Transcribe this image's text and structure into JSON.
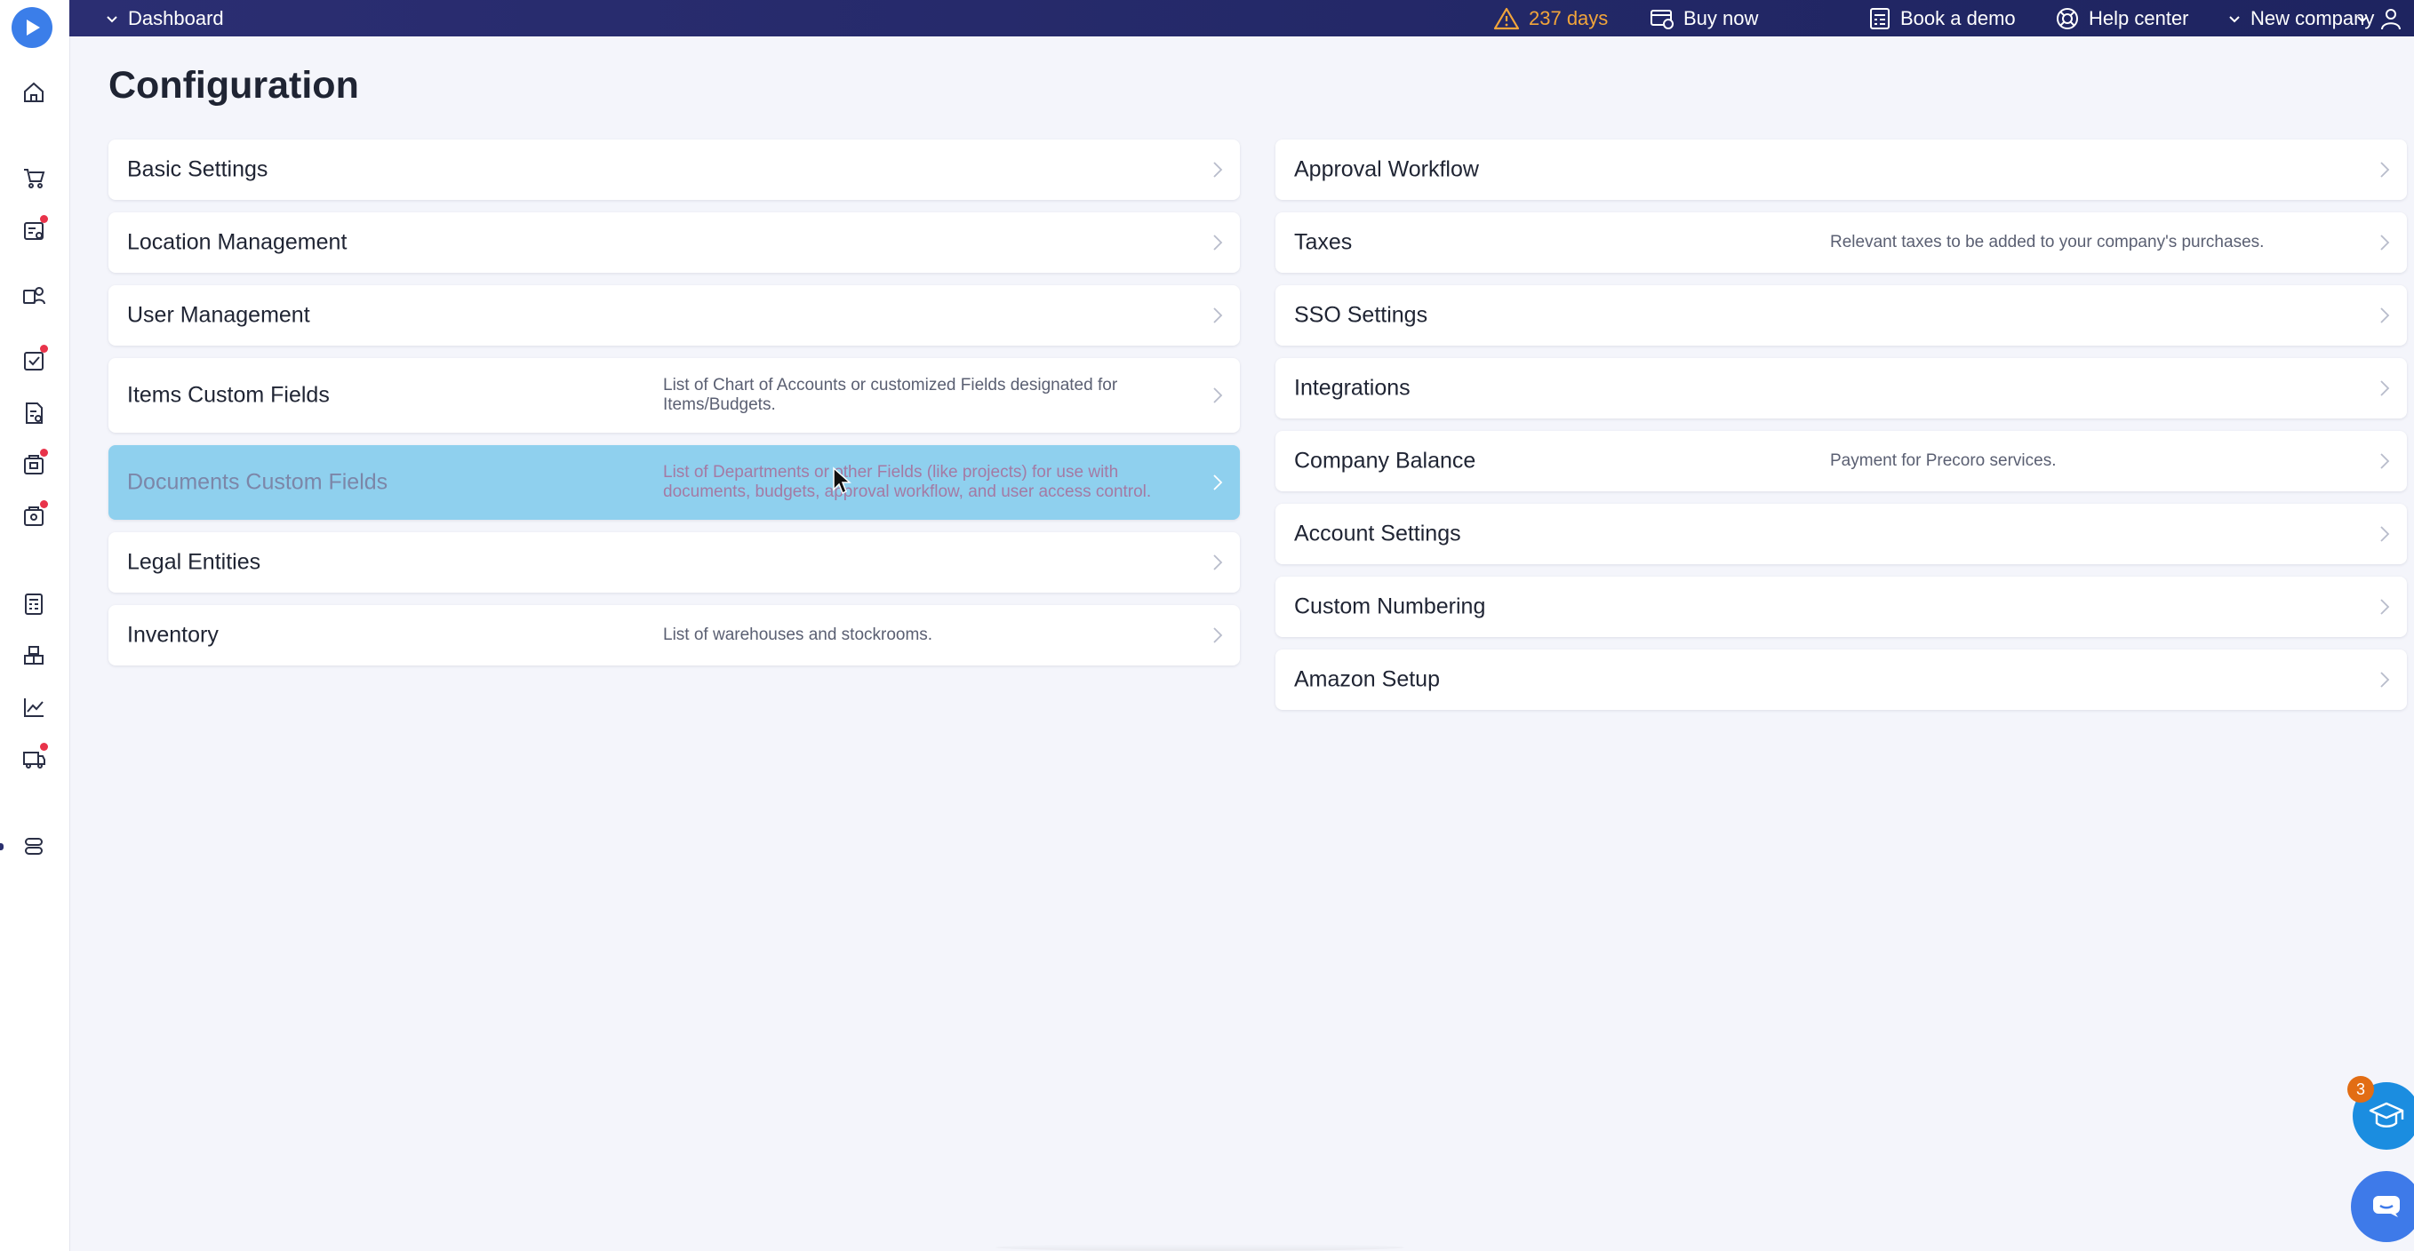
{
  "topbar": {
    "dashboard_label": "Dashboard",
    "trial_label": "237 days",
    "buy_now": "Buy now",
    "book_demo": "Book a demo",
    "help_center": "Help center",
    "company": "New company"
  },
  "page": {
    "title": "Configuration"
  },
  "left_cards": [
    {
      "title": "Basic Settings",
      "desc": ""
    },
    {
      "title": "Location Management",
      "desc": ""
    },
    {
      "title": "User Management",
      "desc": ""
    },
    {
      "title": "Items Custom Fields",
      "desc": "List of Chart of Accounts or customized Fields designated for Items/Budgets."
    },
    {
      "title": "Documents Custom Fields",
      "desc": "List of Departments or other Fields (like projects) for use with documents, budgets, approval workflow, and user access control."
    },
    {
      "title": "Legal Entities",
      "desc": ""
    },
    {
      "title": "Inventory",
      "desc": "List of warehouses and stockrooms."
    }
  ],
  "right_cards": [
    {
      "title": "Approval Workflow",
      "desc": ""
    },
    {
      "title": "Taxes",
      "desc": "Relevant taxes to be added to your company's purchases."
    },
    {
      "title": "SSO Settings",
      "desc": ""
    },
    {
      "title": "Integrations",
      "desc": ""
    },
    {
      "title": "Company Balance",
      "desc": "Payment for Precoro services."
    },
    {
      "title": "Account Settings",
      "desc": ""
    },
    {
      "title": "Custom Numbering",
      "desc": ""
    },
    {
      "title": "Amazon Setup",
      "desc": ""
    }
  ],
  "floating": {
    "education_badge": "3"
  },
  "colors": {
    "topbar": "#2b2e72",
    "accent": "#3b7ee9",
    "trial": "#f2a53a",
    "active_card": "#8fd0ee",
    "notification_dot": "#e8334a",
    "badge": "#e26d14"
  },
  "icons": {
    "sidebar": [
      "home-icon",
      "cart-icon",
      "requests-icon",
      "suppliers-icon",
      "approvals-icon",
      "invoices-icon",
      "receipts-icon",
      "payments-icon",
      "budgets-icon",
      "inventory-icon",
      "analytics-icon",
      "delivery-icon",
      "settings-icon"
    ]
  }
}
